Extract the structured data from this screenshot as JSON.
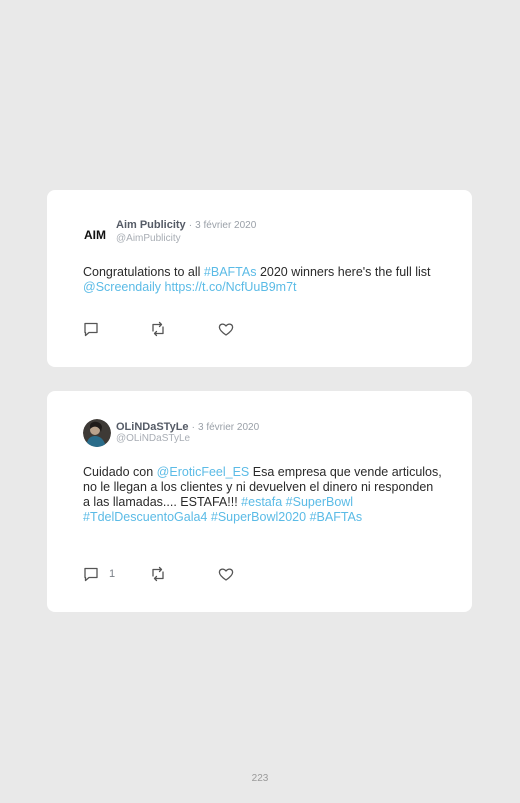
{
  "tweets": [
    {
      "name": "Aim Publicity",
      "separator": "·",
      "date": "3 février 2020",
      "handle": "@AimPublicity",
      "logo_text": "AIM",
      "text_1": "Congratulations to all ",
      "link_1": "#BAFTAs",
      "text_2": " 2020 winners here's the full list ",
      "link_2": "@Screendaily",
      "text_3": " ",
      "link_3": "https://t.co/NcfUuB9m7t",
      "reply_count": "",
      "retweet_count": "",
      "like_count": ""
    },
    {
      "name": "OLiNDaSTyLe",
      "separator": "·",
      "date": "3 février 2020",
      "handle": "@OLiNDaSTyLe",
      "text_1": "Cuidado con ",
      "link_1": "@EroticFeel_ES",
      "text_2": " Esa empresa que vende articulos, no le llegan a los clientes y ni devuelven el dinero ni responden a las llamadas.... ESTAFA!!! ",
      "link_2": "#estafa",
      "text_3": " ",
      "link_3": "#SuperBowl",
      "text_4": " ",
      "link_4": "#TdelDescuentoGala4",
      "text_5": " ",
      "link_5": "#SuperBowl2020",
      "text_6": " ",
      "link_6": "#BAFTAs",
      "reply_count": "1",
      "retweet_count": "",
      "like_count": ""
    }
  ],
  "page_number": "223",
  "colors": {
    "link": "#5bbbe6",
    "background": "#e9e9e9",
    "card": "#ffffff"
  }
}
